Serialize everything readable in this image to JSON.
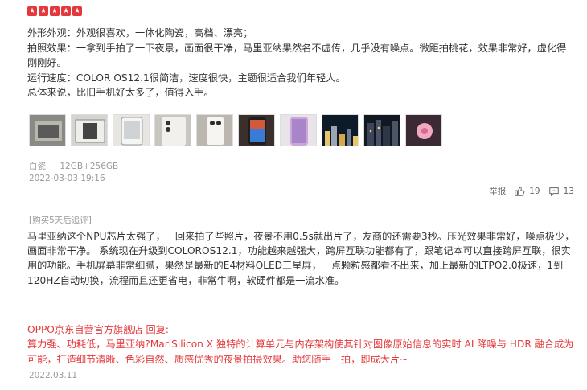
{
  "rating": {
    "stars": 5,
    "color": "#e4393c"
  },
  "review": {
    "lines": [
      "外形外观：外观很喜欢，一体化陶瓷，高档、漂亮；",
      "拍照效果：一拿到手拍了一下夜景，画面很干净，马里亚纳果然名不虚传，几乎没有噪点。微距拍桃花，效果非常好，虚化得刚刚好。",
      "运行速度：COLOR OS12.1很简洁，速度很快，主题很适合我们年轻人。",
      "总体来说，比旧手机好太多了，值得入手。"
    ]
  },
  "thumbnails": [
    "phone-box",
    "phone-in-box",
    "phone-front",
    "phone-back-ceramic",
    "phone-hand",
    "phone-screen",
    "phone-side",
    "night-photo",
    "night-cityscape",
    "flower-macro"
  ],
  "meta": {
    "color_variant": "白瓷",
    "storage": "12GB+256GB",
    "datetime": "2022-03-03 19:16"
  },
  "actions": {
    "report_label": "举报",
    "like_count": "19",
    "comment_count": "13"
  },
  "followup": {
    "tag": "[购买5天后追评]",
    "text": "马里亚纳这个NPU芯片太强了，一回来拍了些照片，夜景不用0.5s就出片了，友商的还需要3秒。压光效果非常好，噪点极少，画面非常干净。 系统现在升级到COLOROS12.1，功能越来越强大，跨屏互联功能都有了，跟笔记本可以直接跨屏互联，很实用的功能。手机屏幕非常细腻，果然是最新的E4材料OLED三星屏，一点颗粒感都看不出来，加上最新的LTPO2.0极速，1到120HZ自动切换，流程而且还更省电，非常牛啊，软硬件都是一流水准。"
  },
  "reply": {
    "text": "OPPO京东自营官方旗舰店 回复:\n算力强、功耗低，马里亚纳?MariSilicon X 独特的计算单元与内存架构使其针对图像原始信息的实时 AI 降噪与 HDR 融合成为可能，打造细节清晰、色彩自然、质感优秀的夜景拍摄效果。助您随手一拍，即成大片~",
    "date": "2022.03.11"
  }
}
